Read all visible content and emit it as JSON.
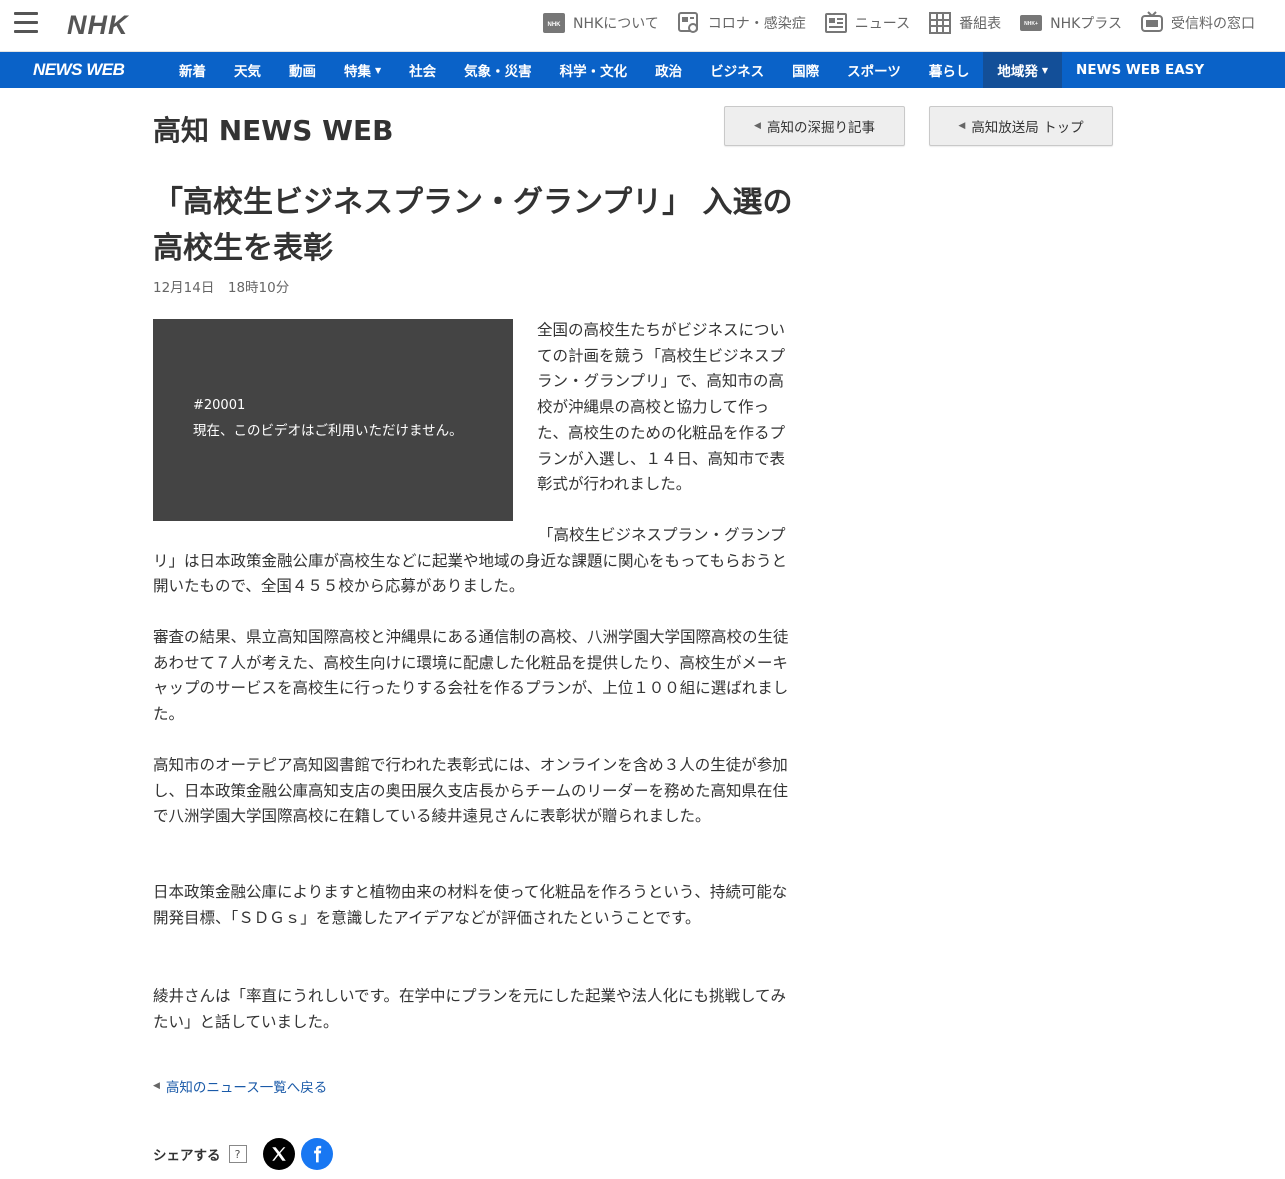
{
  "header": {
    "logo": "NHK",
    "links": [
      {
        "label": "NHKについて",
        "icon": "nhk-badge-icon"
      },
      {
        "label": "コロナ・感染症",
        "icon": "covid-icon"
      },
      {
        "label": "ニュース",
        "icon": "news-icon"
      },
      {
        "label": "番組表",
        "icon": "grid-schedule-icon"
      },
      {
        "label": "NHKプラス",
        "icon": "nhk-plus-icon"
      },
      {
        "label": "受信料の窓口",
        "icon": "tv-icon"
      }
    ]
  },
  "nav": {
    "brand": "NEWS WEB",
    "items": [
      {
        "label": "新着"
      },
      {
        "label": "天気"
      },
      {
        "label": "動画"
      },
      {
        "label": "特集",
        "dropdown": true
      },
      {
        "label": "社会"
      },
      {
        "label": "気象・災害"
      },
      {
        "label": "科学・文化"
      },
      {
        "label": "政治"
      },
      {
        "label": "ビジネス"
      },
      {
        "label": "国際"
      },
      {
        "label": "スポーツ"
      },
      {
        "label": "暮らし"
      },
      {
        "label": "地域発",
        "dropdown": true,
        "active": true
      },
      {
        "label": "NEWS WEB EASY"
      }
    ],
    "colors": {
      "bar": "#0a62c8",
      "active": "#134f98"
    }
  },
  "site": {
    "title": "高知 NEWS WEB",
    "buttons": [
      "高知の深掘り記事",
      "高知放送局 トップ"
    ]
  },
  "article": {
    "headline": "「高校生ビジネスプラン・グランプリ」 入選の高校生を表彰",
    "date": "12月14日　18時10分",
    "video": {
      "code": "#20001",
      "message": "現在、このビデオはご利用いただけません。"
    },
    "paragraphs": [
      "全国の高校生たちがビジネスについての計画を競う「高校生ビジネスプラン・グランプリ」で、高知市の高校が沖縄県の高校と協力して作った、高校生のための化粧品を作るプランが入選し、１４日、高知市で表彰式が行われました。",
      "「高校生ビジネスプラン・グランプリ」は日本政策金融公庫が高校生などに起業や地域の身近な課題に関心をもってもらおうと開いたもので、全国４５５校から応募がありました。",
      "審査の結果、県立高知国際高校と沖縄県にある通信制の高校、八洲学園大学国際高校の生徒あわせて７人が考えた、高校生向けに環境に配慮した化粧品を提供したり、高校生がメーキャップのサービスを高校生に行ったりする会社を作るプランが、上位１００組に選ばれました。",
      "高知市のオーテピア高知図書館で行われた表彰式には、オンラインを含め３人の生徒が参加し、日本政策金融公庫高知支店の奥田展久支店長からチームのリーダーを務めた高知県在住で八洲学園大学国際高校に在籍している綾井遠見さんに表彰状が贈られました。",
      "日本政策金融公庫によりますと植物由来の材料を使って化粧品を作ろうという、持続可能な開発目標、「ＳＤＧｓ」を意識したアイデアなどが評価されたということです。",
      "綾井さんは「率直にうれしいです。在学中にプランを元にした起業や法人化にも挑戦してみたい」と話していました。"
    ],
    "back_link": "高知のニュース一覧へ戻る"
  },
  "share": {
    "label": "シェアする",
    "help": "?",
    "services": [
      "x-icon",
      "facebook-icon"
    ]
  }
}
